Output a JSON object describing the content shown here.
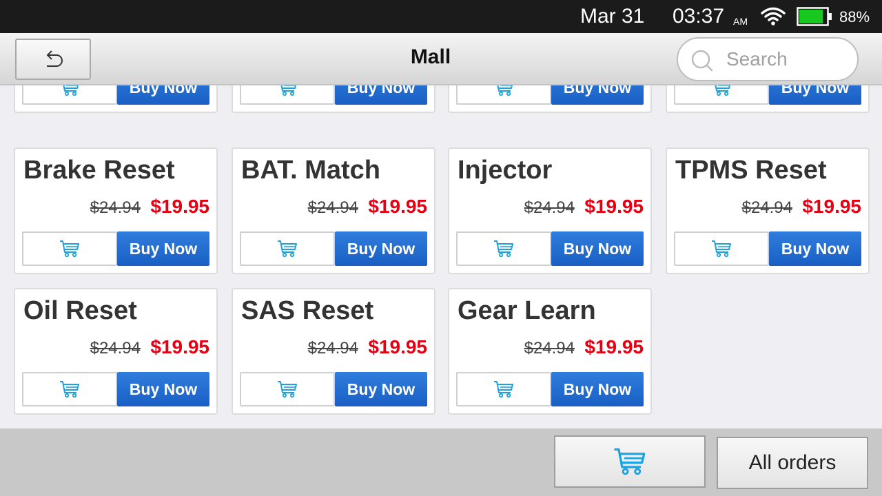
{
  "status": {
    "date": "Mar 31",
    "time": "03:37",
    "ampm": "AM",
    "battery_percent_text": "88%",
    "battery_level": 0.88,
    "battery_color": "#19c81e"
  },
  "header": {
    "title": "Mall",
    "search_placeholder": "Search"
  },
  "colors": {
    "buy_button": "#1f6cd2",
    "sale_price": "#e60012",
    "cart_icon": "#1aa3e0"
  },
  "products": [
    {
      "title": "",
      "old_price": "",
      "price": "",
      "buy_label": "Buy Now"
    },
    {
      "title": "",
      "old_price": "",
      "price": "",
      "buy_label": "Buy Now"
    },
    {
      "title": "",
      "old_price": "",
      "price": "",
      "buy_label": "Buy Now"
    },
    {
      "title": "",
      "old_price": "",
      "price": "",
      "buy_label": "Buy Now"
    },
    {
      "title": "Brake Reset",
      "old_price": "$24.94",
      "price": "$19.95",
      "buy_label": "Buy Now"
    },
    {
      "title": "BAT. Match",
      "old_price": "$24.94",
      "price": "$19.95",
      "buy_label": "Buy Now"
    },
    {
      "title": "Injector",
      "old_price": "$24.94",
      "price": "$19.95",
      "buy_label": "Buy Now"
    },
    {
      "title": "TPMS Reset",
      "old_price": "$24.94",
      "price": "$19.95",
      "buy_label": "Buy Now"
    },
    {
      "title": "Oil Reset",
      "old_price": "$24.94",
      "price": "$19.95",
      "buy_label": "Buy Now"
    },
    {
      "title": "SAS Reset",
      "old_price": "$24.94",
      "price": "$19.95",
      "buy_label": "Buy Now"
    },
    {
      "title": "Gear Learn",
      "old_price": "$24.94",
      "price": "$19.95",
      "buy_label": "Buy Now"
    }
  ],
  "bottom": {
    "all_orders_label": "All orders"
  }
}
